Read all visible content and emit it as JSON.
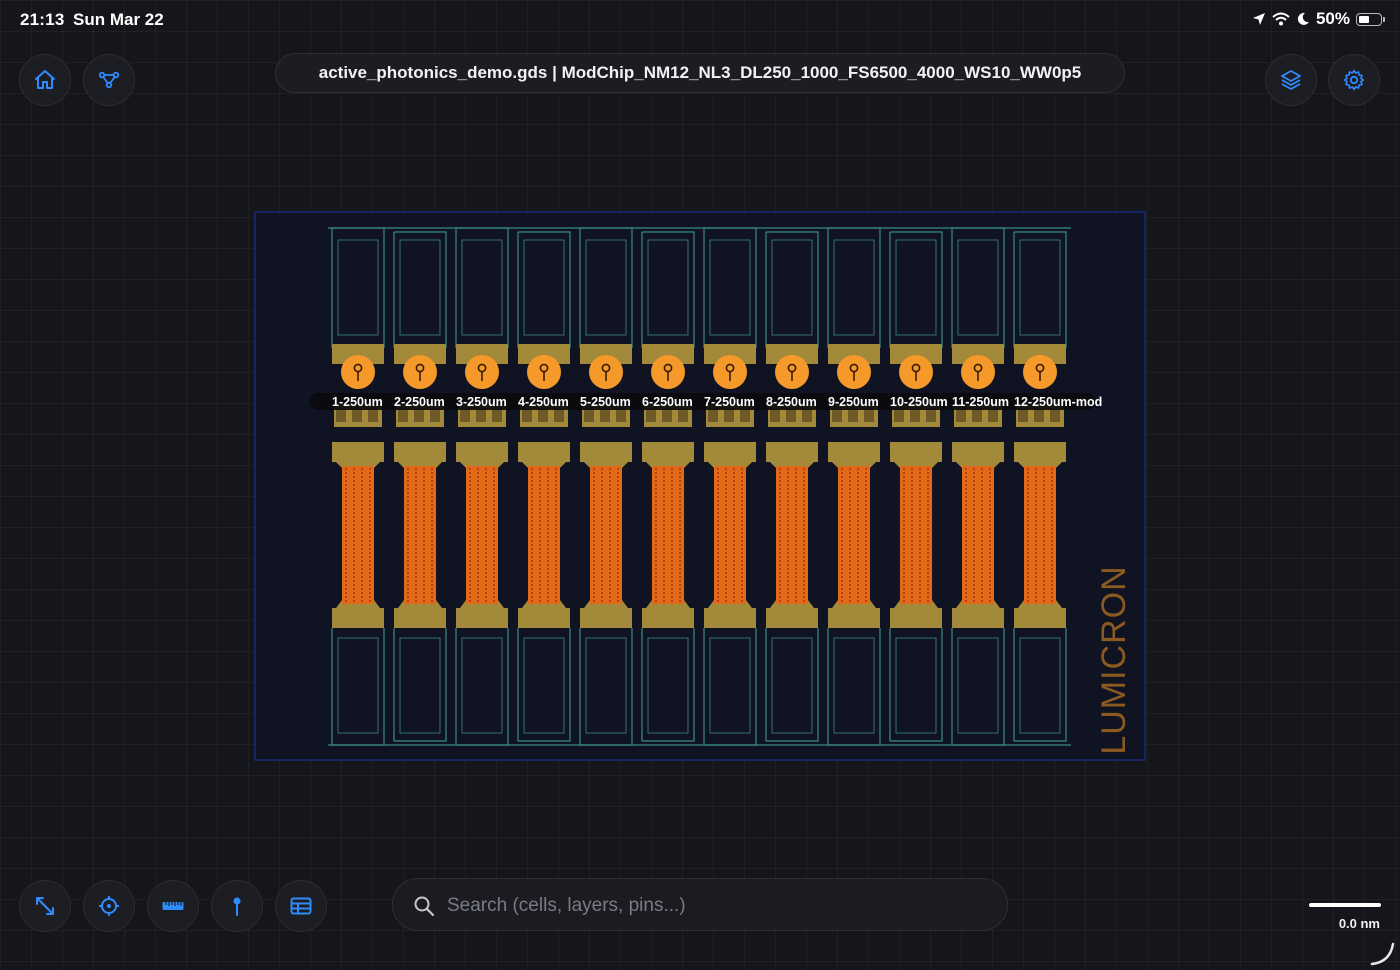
{
  "status_bar": {
    "time": "21:13",
    "date": "Sun Mar 22",
    "battery": "50%",
    "battery_level": 0.5
  },
  "toolbar": {
    "title": "active_photonics_demo.gds | ModChip_NM12_NL3_DL250_1000_FS6500_4000_WS10_WW0p5",
    "left_buttons": [
      "home-icon",
      "hierarchy-icon"
    ],
    "right_buttons": [
      "layers-icon",
      "gear-icon"
    ]
  },
  "bottom_toolbar": {
    "buttons": [
      "fit-view-icon",
      "crosshair-icon",
      "ruler-icon",
      "pin-icon",
      "table-icon"
    ]
  },
  "search": {
    "placeholder": "Search (cells, layers, pins...)",
    "value": ""
  },
  "scale": {
    "label": "0.0 nm"
  },
  "layout": {
    "watermark": "LUMICRON",
    "pins": [
      {
        "label": "1-250um"
      },
      {
        "label": "2-250um"
      },
      {
        "label": "3-250um"
      },
      {
        "label": "4-250um"
      },
      {
        "label": "5-250um"
      },
      {
        "label": "6-250um"
      },
      {
        "label": "7-250um"
      },
      {
        "label": "8-250um"
      },
      {
        "label": "9-250um"
      },
      {
        "label": "10-250um"
      },
      {
        "label": "11-250um"
      },
      {
        "label": "12-250um-mod"
      }
    ]
  },
  "colors": {
    "accent": "#2f8cff",
    "outline": "#3b8a7f",
    "metal": "#a3893a",
    "active": "#e06a17",
    "pin": "#f59a2a"
  }
}
